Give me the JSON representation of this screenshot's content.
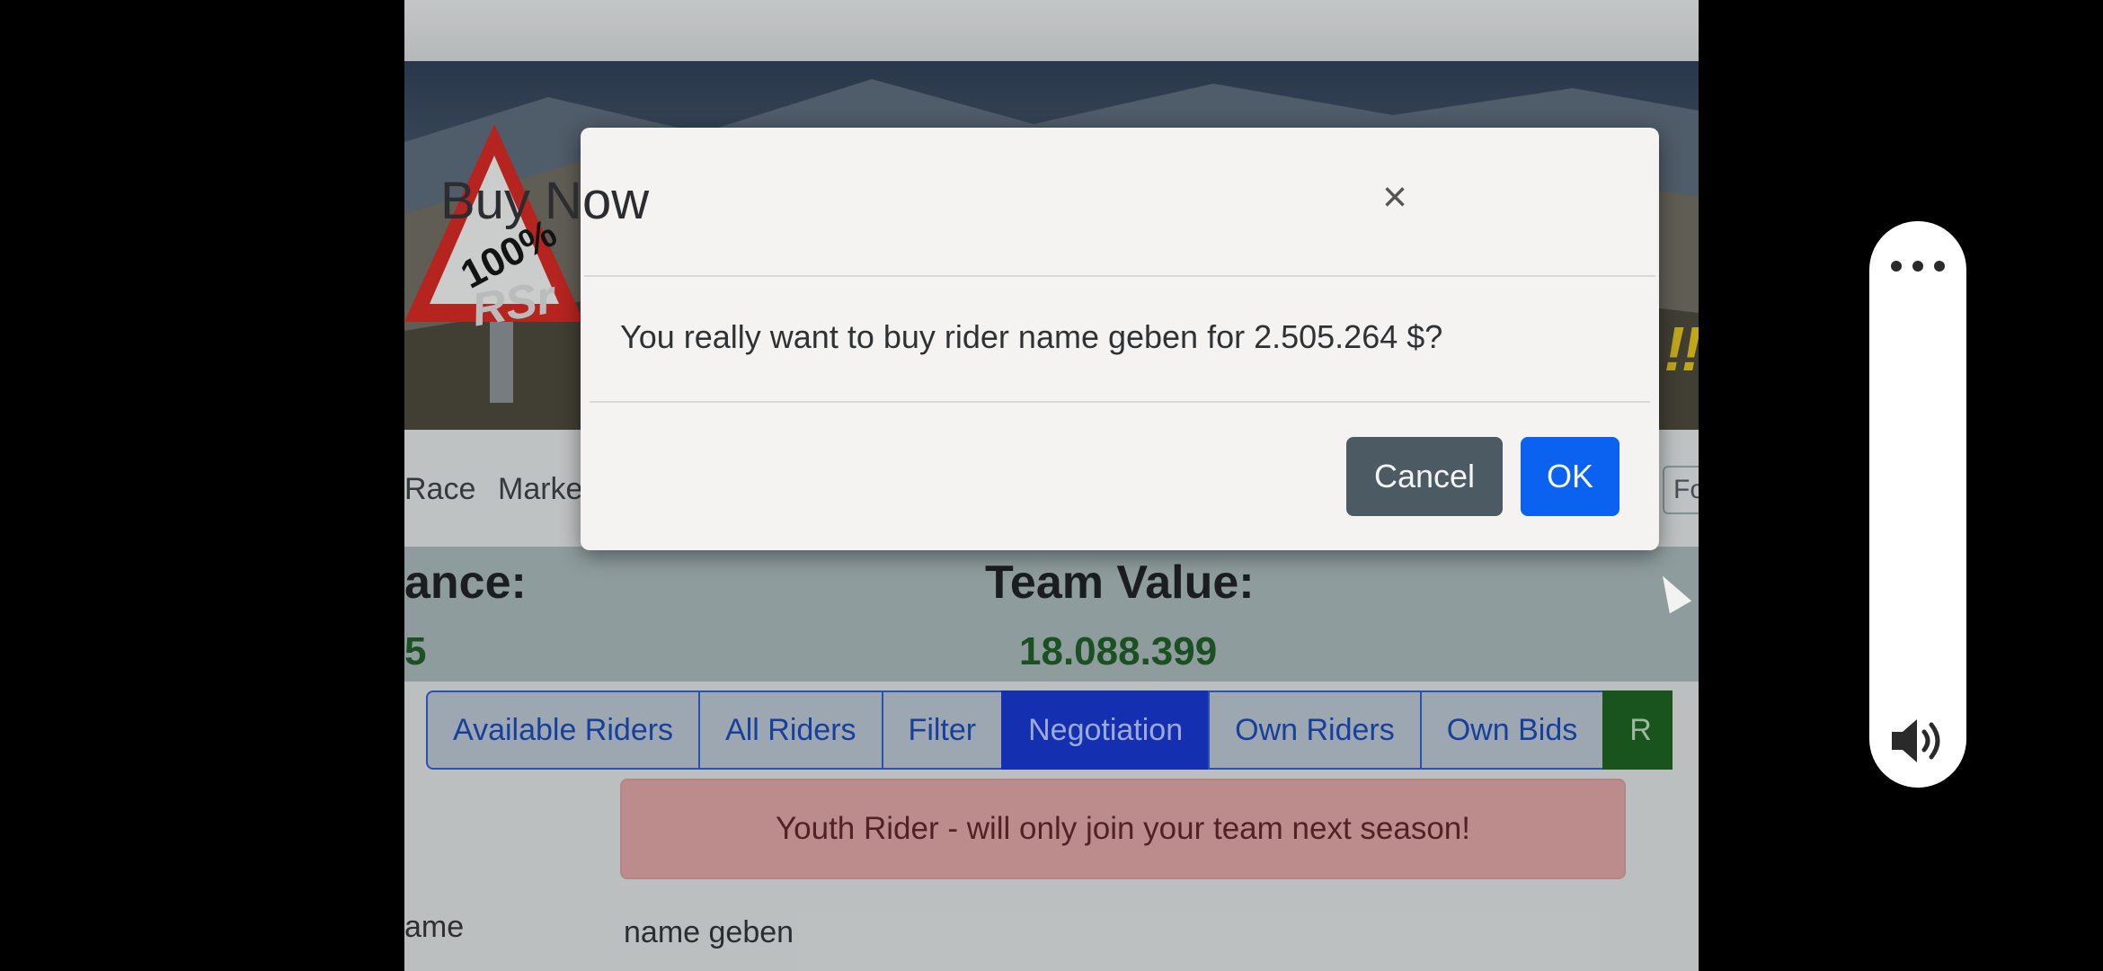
{
  "banner": {
    "sign_text": "100%",
    "sign_subtext": "RSr"
  },
  "nav": {
    "items": [
      "Race",
      "Marke"
    ],
    "right_item": "Fo"
  },
  "stats": {
    "balance_label": "ance:",
    "balance_value": "5",
    "team_value_label": "Team Value:",
    "team_value": "18.088.399"
  },
  "tabs": [
    {
      "label": "Available Riders",
      "active": false
    },
    {
      "label": "All Riders",
      "active": false
    },
    {
      "label": "Filter",
      "active": false
    },
    {
      "label": "Negotiation",
      "active": true
    },
    {
      "label": "Own Riders",
      "active": false
    },
    {
      "label": "Own Bids",
      "active": false
    },
    {
      "label": "R",
      "active": false
    }
  ],
  "alert": {
    "text": "Youth Rider - will only join your team next season!"
  },
  "rider_row": {
    "label": "ame",
    "value": "name geben"
  },
  "modal": {
    "title": "Buy Now",
    "close_glyph": "×",
    "message": "You really want to buy rider name geben for 2.505.264 $?",
    "cancel_label": "Cancel",
    "ok_label": "OK"
  },
  "colors": {
    "ok_button": "#0b62f0",
    "cancel_button": "#4c5a63",
    "active_tab": "#1333d0",
    "alert_bg": "#e0a3a3",
    "team_value_text": "#1c5a22"
  },
  "side_panel": {
    "icons": [
      "more-icon",
      "volume-icon"
    ]
  }
}
